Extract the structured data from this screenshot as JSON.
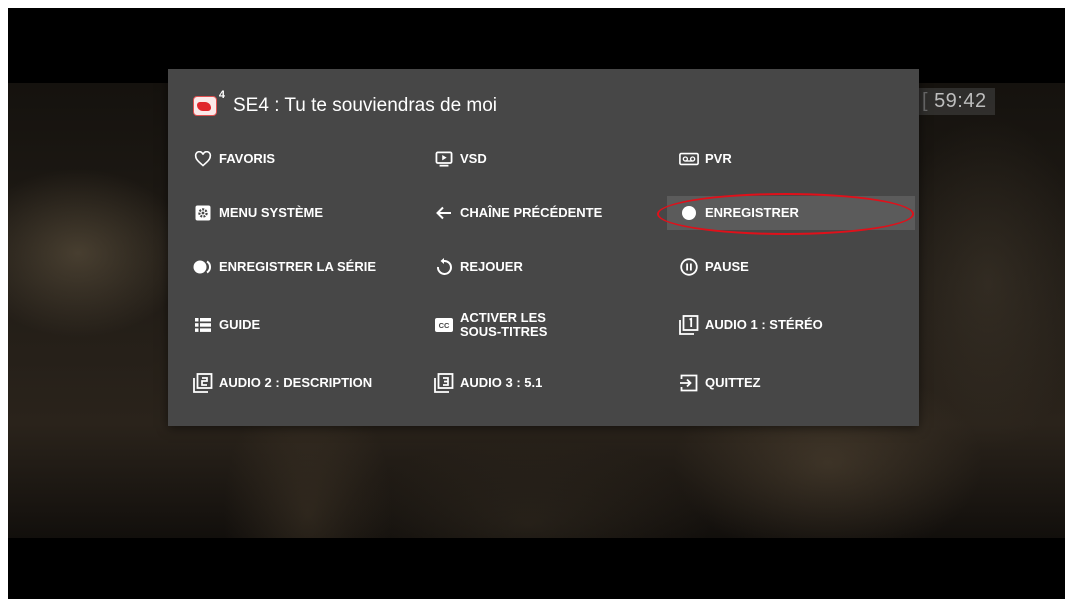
{
  "player": {
    "timecode": "59:42"
  },
  "menu": {
    "channel_logo_number": "4",
    "title": "SE4 : Tu te souviendras de moi",
    "items": [
      {
        "label": "FAVORIS",
        "icon": "heart-icon"
      },
      {
        "label": "VSD",
        "icon": "play-screen-icon"
      },
      {
        "label": "PVR",
        "icon": "cassette-icon"
      },
      {
        "label": "MENU SYSTÈME",
        "icon": "gear-icon"
      },
      {
        "label": "CHAÎNE PRÉCÉDENTE",
        "icon": "arrow-left-icon"
      },
      {
        "label": "ENREGISTRER",
        "icon": "record-dot-icon",
        "selected": true
      },
      {
        "label": "ENREGISTRER LA SÉRIE",
        "icon": "record-series-icon"
      },
      {
        "label": "REJOUER",
        "icon": "replay-icon"
      },
      {
        "label": "PAUSE",
        "icon": "pause-circle-icon"
      },
      {
        "label": "GUIDE",
        "icon": "list-icon"
      },
      {
        "label": "ACTIVER LES SOUS-TITRES",
        "icon": "cc-icon"
      },
      {
        "label": "AUDIO 1 : STÉRÉO",
        "icon": "audio-1-icon"
      },
      {
        "label": "AUDIO 2 : DESCRIPTION",
        "icon": "audio-2-icon"
      },
      {
        "label": "AUDIO 3 : 5.1",
        "icon": "audio-3-icon"
      },
      {
        "label": "QUITTEZ",
        "icon": "exit-icon"
      }
    ]
  },
  "colors": {
    "panel": "#474747",
    "selected_row": "#5b5b5b",
    "annotation_ring": "#e0101a",
    "text": "#ffffff"
  }
}
